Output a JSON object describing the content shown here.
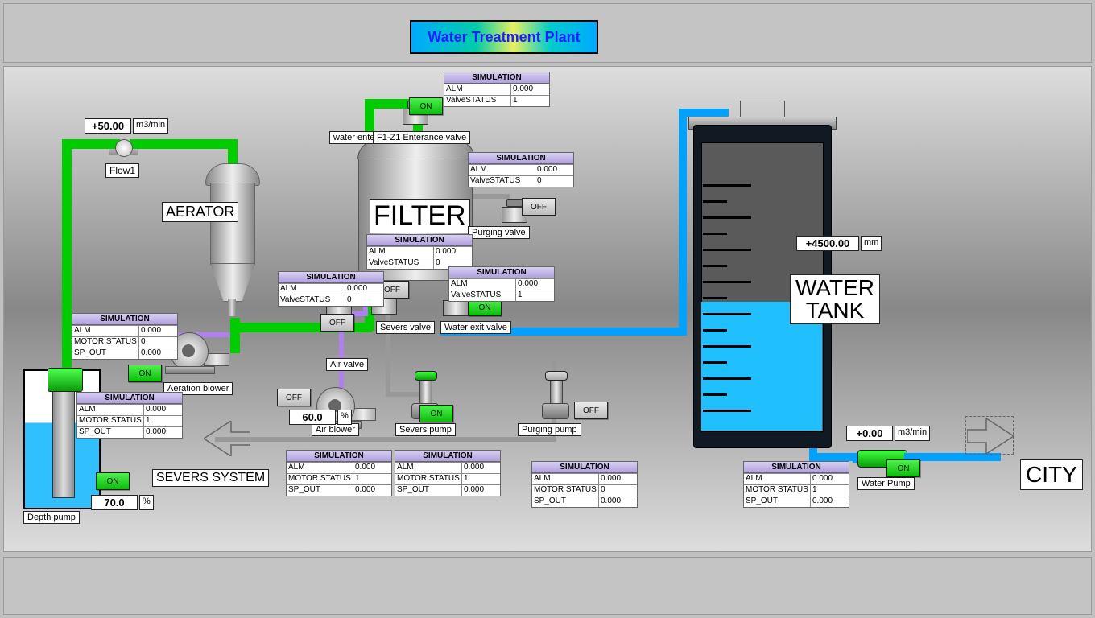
{
  "title": "Water Treatment Plant",
  "labels": {
    "flow1": "Flow1",
    "aerator": "AERATOR",
    "filter": "FILTER",
    "depth_pump": "Depth pump",
    "aeration_blower": "Aeration blower",
    "air_blower": "Air blower",
    "air_valve": "Air valve",
    "severs_valve": "Severs valve",
    "severs_pump": "Severs pump",
    "purging_pump": "Purging pump",
    "purging_valve": "Purging valve",
    "water_enters": "water enters",
    "entrance_valve": "F1-Z1 Enterance valve",
    "water_exit_valve": "Water exit valve",
    "water_tank": "WATER\nTANK",
    "water_pump": "Water Pump",
    "severs_system": "SEVERS SYSTEM",
    "city": "CITY"
  },
  "buttons": {
    "on": "ON",
    "off": "OFF"
  },
  "values": {
    "flow1": "+50.00",
    "flow1_unit": "m3/min",
    "depth_speed": "70.0",
    "depth_unit": "%",
    "airblower_speed": "60.0",
    "airblower_unit": "%",
    "tank_level": "+4500.00",
    "tank_unit": "mm",
    "flow2": "+0.00",
    "flow2_unit": "m3/min"
  },
  "sim": {
    "header": "SIMULATION",
    "k_alm": "ALM",
    "k_valve_status": "ValveSTATUS",
    "k_motor_status": "MOTOR STATUS",
    "k_sp_out": "SP_OUT",
    "entrance": {
      "alm": "0.000",
      "valve_status": "1"
    },
    "purging_valve": {
      "alm": "0.000",
      "valve_status": "0"
    },
    "severs_valve": {
      "alm": "0.000",
      "valve_status": "0"
    },
    "water_exit": {
      "alm": "0.000",
      "valve_status": "1"
    },
    "air_valve": {
      "alm": "0.000",
      "valve_status": "0"
    },
    "depth_pump": {
      "alm": "0.000",
      "motor_status": "0",
      "sp_out": "0.000"
    },
    "depth_pump2": {
      "alm": "0.000",
      "motor_status": "1",
      "sp_out": "0.000"
    },
    "severs_pump": {
      "alm": "0.000",
      "motor_status": "1",
      "sp_out": "0.000"
    },
    "air_blower": {
      "alm": "0.000",
      "motor_status": "1",
      "sp_out": "0.000"
    },
    "purging_pump": {
      "alm": "0.000",
      "motor_status": "0",
      "sp_out": "0.000"
    },
    "water_pump": {
      "alm": "0.000",
      "motor_status": "1",
      "sp_out": "0.000"
    }
  }
}
